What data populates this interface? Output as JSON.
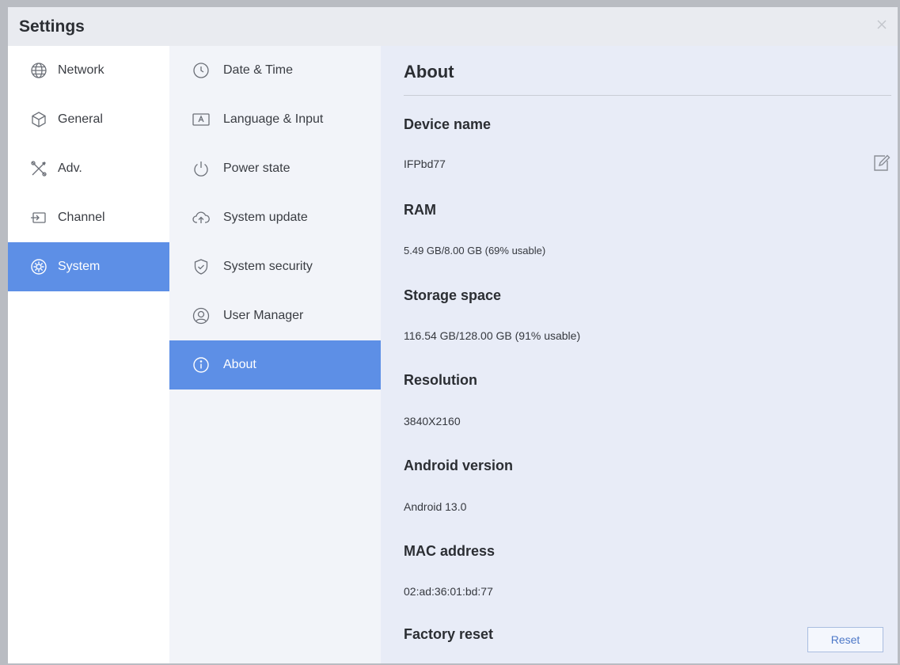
{
  "window": {
    "title": "Settings"
  },
  "primary_nav": [
    {
      "label": "Network",
      "icon": "globe-icon"
    },
    {
      "label": "General",
      "icon": "cube-icon"
    },
    {
      "label": "Adv.",
      "icon": "tools-icon"
    },
    {
      "label": "Channel",
      "icon": "input-source-icon"
    },
    {
      "label": "System",
      "icon": "gear-icon",
      "active": true
    }
  ],
  "secondary_nav": [
    {
      "label": "Date & Time",
      "icon": "clock-icon"
    },
    {
      "label": "Language & Input",
      "icon": "keyboard-letter-icon"
    },
    {
      "label": "Power state",
      "icon": "power-icon"
    },
    {
      "label": "System update",
      "icon": "cloud-upload-icon"
    },
    {
      "label": "System security",
      "icon": "shield-check-icon"
    },
    {
      "label": "User Manager",
      "icon": "user-icon"
    },
    {
      "label": "About",
      "icon": "info-icon",
      "active": true
    }
  ],
  "about": {
    "title": "About",
    "device_name": {
      "label": "Device name",
      "value": "IFPbd77"
    },
    "ram": {
      "label": "RAM",
      "value": "5.49 GB/8.00 GB (69% usable)"
    },
    "storage": {
      "label": "Storage space",
      "value": "116.54 GB/128.00 GB (91% usable)"
    },
    "resolution": {
      "label": "Resolution",
      "value": "3840X2160"
    },
    "android_version": {
      "label": "Android version",
      "value": "Android 13.0"
    },
    "mac_address": {
      "label": "MAC address",
      "value": "02:ad:36:01:bd:77"
    },
    "factory_reset": {
      "label": "Factory reset",
      "button_label": "Reset"
    }
  },
  "colors": {
    "accent": "#5d8fe6",
    "background": "#eef0f5"
  }
}
